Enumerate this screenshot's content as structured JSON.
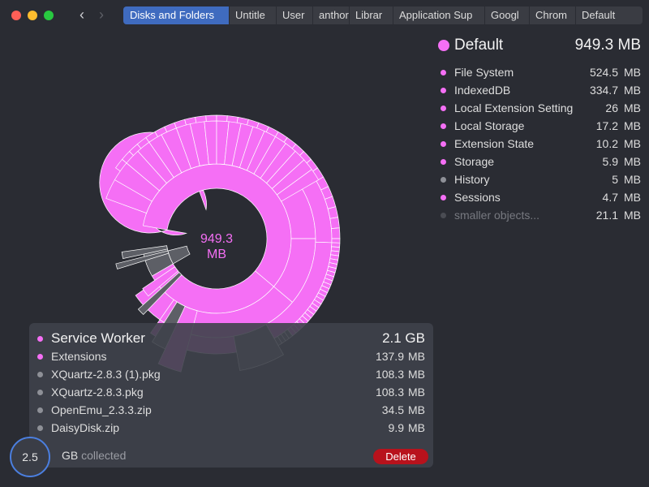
{
  "window": {
    "nav": {
      "back_icon": "chevron-left-icon",
      "forward_icon": "chevron-right-icon"
    },
    "breadcrumbs": [
      {
        "label": "Disks and Folders",
        "active": true
      },
      {
        "label": "Untitle"
      },
      {
        "label": "User"
      },
      {
        "label": "anthor"
      },
      {
        "label": "Librar"
      },
      {
        "label": "Application Sup"
      },
      {
        "label": "Googl"
      },
      {
        "label": "Chrom"
      },
      {
        "label": "Default"
      }
    ]
  },
  "colors": {
    "accent": "#f56ff5",
    "grey_dot": "#8e9097",
    "dim_dot": "#4a4c53",
    "selection_blue": "#3f6bbf",
    "delete_red": "#b8121c"
  },
  "stats": {
    "title": "Default",
    "total": "949.3 MB",
    "items": [
      {
        "label": "File System",
        "value": "524.5",
        "unit": "MB",
        "color": "#f56ff5"
      },
      {
        "label": "IndexedDB",
        "value": "334.7",
        "unit": "MB",
        "color": "#f56ff5"
      },
      {
        "label": "Local Extension Setting",
        "value": "26",
        "unit": "MB",
        "color": "#f56ff5"
      },
      {
        "label": "Local Storage",
        "value": "17.2",
        "unit": "MB",
        "color": "#f56ff5"
      },
      {
        "label": "Extension State",
        "value": "10.2",
        "unit": "MB",
        "color": "#f56ff5"
      },
      {
        "label": "Storage",
        "value": "5.9",
        "unit": "MB",
        "color": "#f56ff5"
      },
      {
        "label": "History",
        "value": "5",
        "unit": "MB",
        "color": "#8e9097"
      },
      {
        "label": "Sessions",
        "value": "4.7",
        "unit": "MB",
        "color": "#f56ff5"
      },
      {
        "label": "smaller objects...",
        "value": "21.1",
        "unit": "MB",
        "color": "#4a4c53",
        "dim": true
      }
    ]
  },
  "sunburst": {
    "center_value": "949.3",
    "center_unit": "MB"
  },
  "collector": {
    "title": "Service Worker",
    "title_size": "2.1 GB",
    "items": [
      {
        "label": "Extensions",
        "value": "137.9",
        "unit": "MB",
        "color": "#f56ff5"
      },
      {
        "label": "XQuartz-2.8.3 (1).pkg",
        "value": "108.3",
        "unit": "MB",
        "color": "#8e9097"
      },
      {
        "label": "XQuartz-2.8.3.pkg",
        "value": "108.3",
        "unit": "MB",
        "color": "#8e9097"
      },
      {
        "label": "OpenEmu_2.3.3.zip",
        "value": "34.5",
        "unit": "MB",
        "color": "#8e9097"
      },
      {
        "label": "DaisyDisk.zip",
        "value": "9.9",
        "unit": "MB",
        "color": "#8e9097"
      }
    ],
    "collected_amount": "2.5",
    "collected_unit": "GB",
    "collected_label": "collected",
    "delete_label": "Delete"
  }
}
